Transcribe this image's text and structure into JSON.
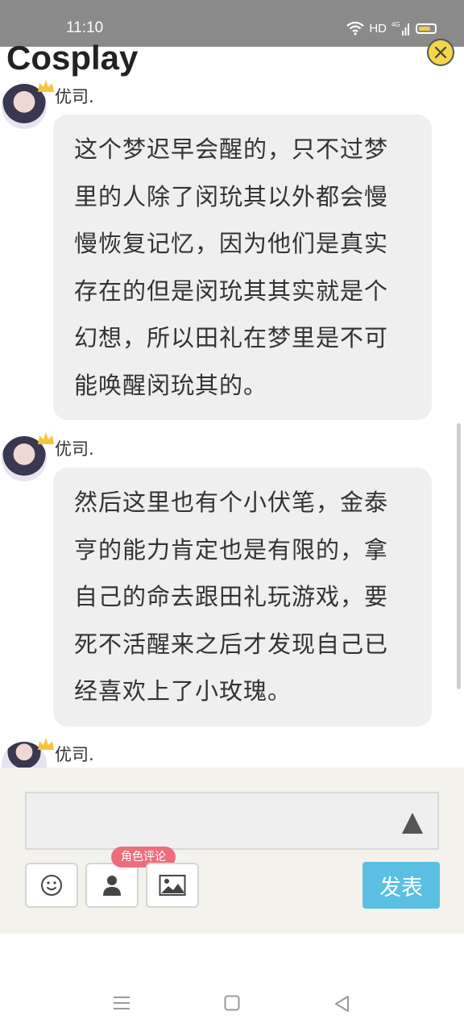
{
  "status_bar": {
    "time": "11:10",
    "network_label": "HD",
    "signal_label": "4G"
  },
  "app": {
    "title": "Cosplay"
  },
  "messages": [
    {
      "username": "优司.",
      "lines": [
        "这个梦迟早会醒的，只不过梦",
        "里的人除了闵玧其以外都会慢",
        "慢恢复记忆，因为他们是真实",
        "存在的但是闵玧其其实就是个",
        "幻想，所以田礼在梦里是不可",
        "能唤醒闵玧其的。"
      ]
    },
    {
      "username": "优司.",
      "lines": [
        "然后这里也有个小伏笔，金泰",
        "亨的能力肯定也是有限的，拿",
        "自己的命去跟田礼玩游戏，要",
        "死不活醒来之后才发现自己已",
        "经喜欢上了小玫瑰。"
      ]
    },
    {
      "username": "优司."
    }
  ],
  "composer": {
    "input_value": "",
    "role_comment_tag": "角色评论",
    "send_label": "发表"
  },
  "colors": {
    "accent_send": "#5bbfe3",
    "role_tag": "#ec6e7d",
    "close_button": "#f2d64c"
  },
  "icons": {
    "close": "close-icon",
    "emoji": "smiley-icon",
    "role": "person-icon",
    "image": "image-icon",
    "expand": "triangle-up-icon"
  }
}
